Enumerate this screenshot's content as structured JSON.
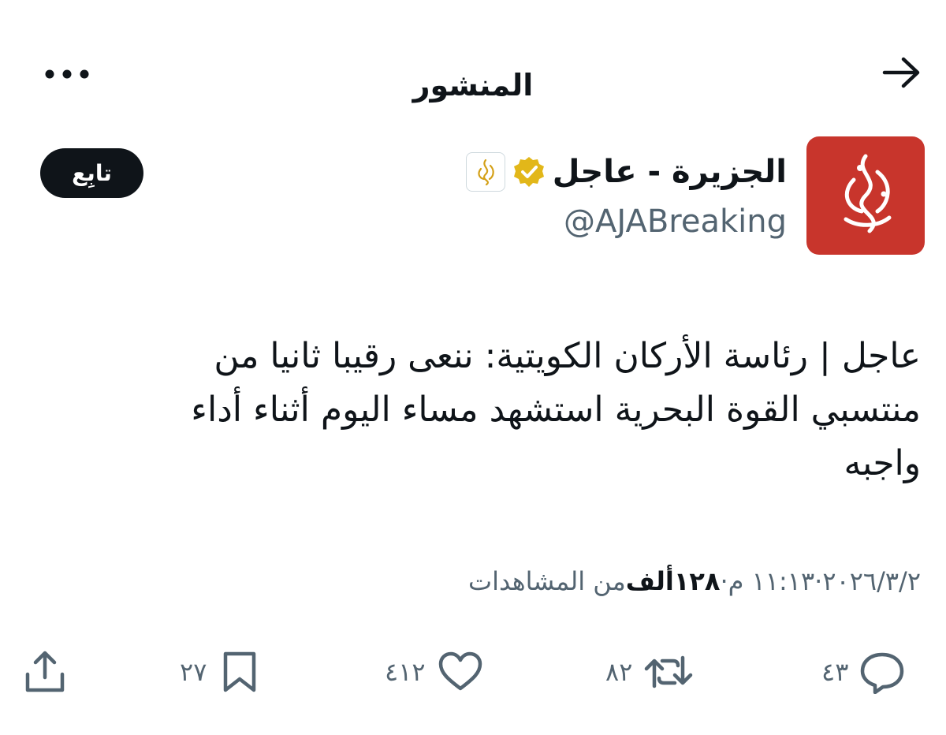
{
  "header": {
    "title": "المنشور",
    "back_icon": "arrow-right-icon",
    "more_icon": "more-dots-icon"
  },
  "author": {
    "display_name": "الجزيرة - عاجل",
    "handle": "@AJABreaking",
    "follow_label": "تابِع",
    "avatar_color": "#c8352c",
    "verified_color": "#e2b719"
  },
  "tweet": {
    "lines": [
      "عاجل | رئاسة الأركان الكويتية: ننعى رقيبا ثانيا من",
      "منتسبي القوة البحرية استشهد مساء اليوم أثناء أداء",
      "واجبه"
    ]
  },
  "meta": {
    "date": "٢٠٢٦/٣/٢",
    "sep": " · ",
    "time": "١١:١٣ م",
    "views_count": "١٢٨ألف",
    "views_label": " من المشاهدات"
  },
  "actions": {
    "replies": "٤٣",
    "reposts": "٨٢",
    "likes": "٤١٢",
    "bookmarks": "٢٧"
  }
}
